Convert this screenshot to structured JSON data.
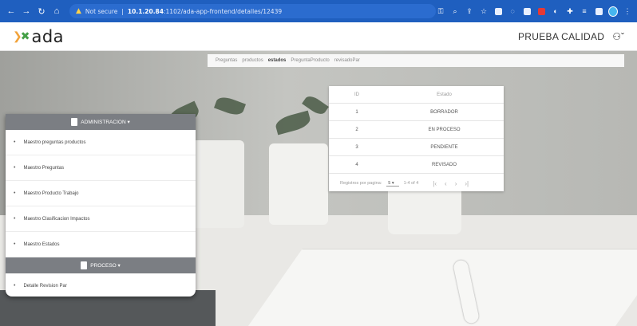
{
  "browser": {
    "not_secure": "Not secure",
    "host": "10.1.20.84",
    "path": ":1102/ada-app-frontend/detalles/12439"
  },
  "app": {
    "logo_text": "ada",
    "user_name": "PRUEBA CALIDAD"
  },
  "tabs": [
    "Preguntas",
    "productos",
    "estados",
    "PreguntaProducto",
    "revisadoPar"
  ],
  "estados_table": {
    "headers": [
      "ID",
      "Estado"
    ],
    "rows": [
      {
        "id": "1",
        "estado": "BORRADOR"
      },
      {
        "id": "2",
        "estado": "EN PROCESO"
      },
      {
        "id": "3",
        "estado": "PENDIENTE"
      },
      {
        "id": "4",
        "estado": "REVISADO"
      }
    ],
    "pager": {
      "label": "Registros por pagina:",
      "size": "5",
      "range": "1-4 of 4"
    }
  },
  "menu": {
    "admin_section": "ADMINISTRACION ▾",
    "admin_items": [
      "Maestro preguntas productos",
      "Maestro Preguntas",
      "Maestro Producto Trabajo",
      "Maestro Clasificacion Impactos",
      "Maestro Estados"
    ],
    "process_section": "PROCESO ▾",
    "process_items": [
      "Detalle Revision Par"
    ]
  },
  "colors": {
    "browser_bar": "#1f5fbf",
    "menu_section": "#7b7e83"
  }
}
